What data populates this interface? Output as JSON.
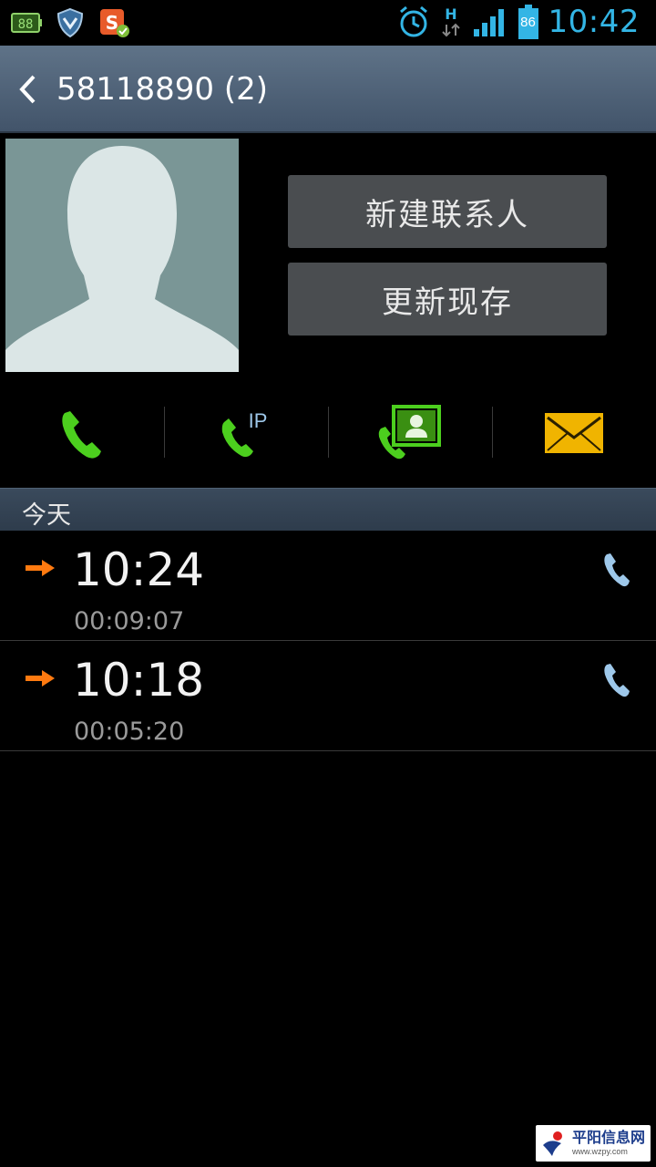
{
  "status_bar": {
    "time": "10:42",
    "battery_level": "86",
    "network_type": "H",
    "left_icons": [
      "battery-saver-icon",
      "shield-icon",
      "sogou-input-icon"
    ],
    "right_icons": [
      "alarm-icon",
      "data-transfer-icon",
      "signal-icon",
      "battery-icon"
    ],
    "accent_color": "#33b5e5"
  },
  "action_bar": {
    "title": "58118890 (2)"
  },
  "contact": {
    "new_contact_label": "新建联系人",
    "update_existing_label": "更新现存"
  },
  "actions": {
    "icons": [
      "call-icon",
      "ip-call-icon",
      "video-call-icon",
      "message-icon"
    ],
    "ip_label": "IP"
  },
  "section": {
    "label": "今天"
  },
  "call_log": [
    {
      "time": "10:24",
      "duration": "00:09:07",
      "type": "outgoing"
    },
    {
      "time": "10:18",
      "duration": "00:05:20",
      "type": "outgoing"
    }
  ],
  "watermark": {
    "name": "平阳信息网",
    "url": "www.wzpy.com"
  },
  "colors": {
    "call_green": "#4ccf1e",
    "outgoing_orange": "#ff7a10",
    "mail_yellow": "#f0b400",
    "log_call_icon": "#9ec8ea"
  }
}
